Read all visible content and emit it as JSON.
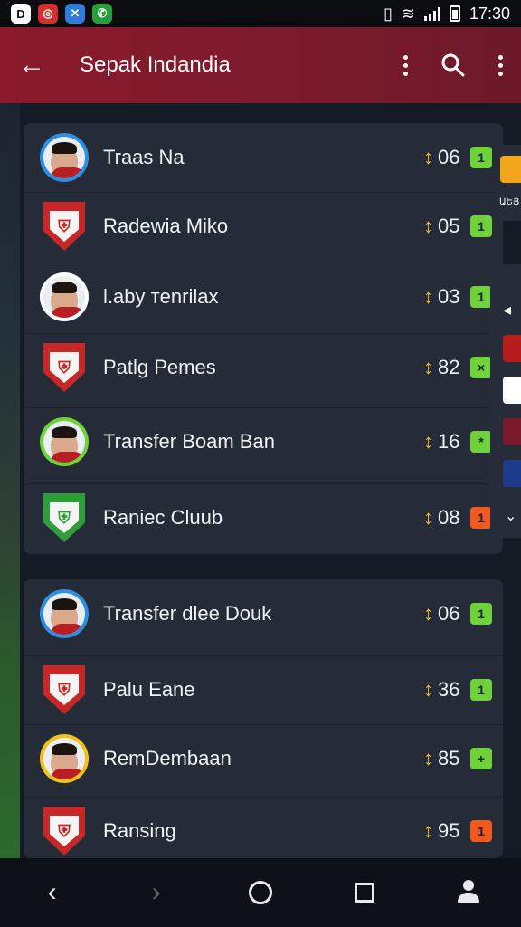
{
  "status_bar": {
    "time": "17:30",
    "apps": [
      {
        "icon": "d-app-icon",
        "glyph": "D",
        "color": "#ffffff"
      },
      {
        "icon": "news-app-icon",
        "glyph": "◎",
        "color": "#d32f2f"
      },
      {
        "icon": "maps-app-icon",
        "glyph": "✕",
        "color": "#2f7fd8"
      },
      {
        "icon": "whatsapp-icon",
        "glyph": "✆",
        "color": "#2b9e3c"
      }
    ]
  },
  "app_bar": {
    "title": "Sepak Indandia"
  },
  "card1": {
    "rows": [
      {
        "name": "Traas Na",
        "score": "06",
        "badge": "1",
        "badge_color": "#6fd23a",
        "avatar": "player",
        "ring": "#2d8fe0"
      },
      {
        "name": "Radewia Miko",
        "score": "05",
        "badge": "1",
        "badge_color": "#6fd23a",
        "avatar": "crest",
        "ring": "#c62828"
      },
      {
        "name": "l.aby тenrilax",
        "score": "03",
        "badge": "1",
        "badge_color": "#6fd23a",
        "avatar": "player",
        "ring": "#ffffff"
      },
      {
        "name": "Patlg Pemes",
        "score": "82",
        "badge": "×",
        "badge_color": "#6fd23a",
        "avatar": "crest",
        "ring": "#c62828"
      },
      {
        "name": "Transfer Boam Ban",
        "score": "16",
        "badge": "*",
        "badge_color": "#6fd23a",
        "avatar": "player",
        "ring": "#6fd23a"
      },
      {
        "name": "Raniec Cluub",
        "score": "08",
        "badge": "1",
        "badge_color": "#f05a1e",
        "avatar": "crest",
        "ring": "#2e9d3a"
      }
    ]
  },
  "card2": {
    "rows": [
      {
        "name": "Transfer dlee Douk",
        "score": "06",
        "badge": "1",
        "badge_color": "#6fd23a",
        "avatar": "player",
        "ring": "#2d8fe0"
      },
      {
        "name": "Palu Eane",
        "score": "36",
        "badge": "1",
        "badge_color": "#6fd23a",
        "avatar": "crest",
        "ring": "#c62828"
      },
      {
        "name": "RemDembaan",
        "score": "85",
        "badge": "+",
        "badge_color": "#6fd23a",
        "avatar": "player",
        "ring": "#f2c21b"
      },
      {
        "name": "Ransing",
        "score": "95",
        "badge": "1",
        "badge_color": "#f05a1e",
        "avatar": "crest",
        "ring": "#c62828"
      }
    ]
  },
  "side_panel": {
    "label": "ԱԵՅ"
  },
  "colors": {
    "accent": "#8a1a2c",
    "arrow": "#f0b429",
    "green_badge": "#6fd23a",
    "orange_badge": "#f05a1e"
  }
}
